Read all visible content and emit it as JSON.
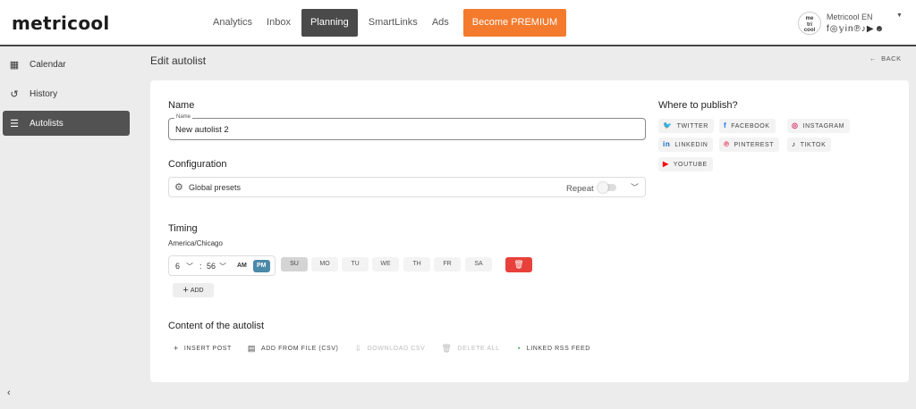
{
  "header": {
    "logo": "metricool",
    "nav": [
      "Analytics",
      "Inbox",
      "Planning",
      "SmartLinks",
      "Ads"
    ],
    "premium": "Become PREMIUM",
    "account": {
      "avatar_text": "me\ntri\ncool",
      "name": "Metricool EN",
      "social_icons": "f◎𝕪in℗♪▶☻"
    }
  },
  "sidebar": {
    "items": [
      {
        "label": "Calendar",
        "icon": "calendar-icon",
        "glyph": "▦"
      },
      {
        "label": "History",
        "icon": "history-icon",
        "glyph": "↺"
      },
      {
        "label": "Autolists",
        "icon": "list-icon",
        "glyph": "☰"
      }
    ],
    "collapse": "‹"
  },
  "page": {
    "title": "Edit autolist",
    "back": "BACK"
  },
  "form": {
    "name_section": "Name",
    "name_field_label": "Name",
    "name_value": "New autolist 2",
    "config_section": "Configuration",
    "config_label": "Global presets",
    "repeat_label": "Repeat",
    "timing_section": "Timing",
    "timezone": "America/Chicago",
    "hour": "6",
    "minute": "56",
    "am": "AM",
    "pm": "PM",
    "days": [
      "SU",
      "MO",
      "TU",
      "WE",
      "TH",
      "FR",
      "SA"
    ],
    "selected_day": "SU",
    "add_label": "ADD",
    "content_section": "Content of the autolist",
    "actions": [
      {
        "label": "INSERT POST",
        "icon": "+",
        "disabled": false
      },
      {
        "label": "ADD FROM FILE (CSV)",
        "icon": "▤",
        "disabled": false
      },
      {
        "label": "DOWNLOAD CSV",
        "icon": "⇩",
        "disabled": true
      },
      {
        "label": "DELETE ALL",
        "icon": "🗑",
        "disabled": true
      },
      {
        "label": "LINKED RSS FEED",
        "icon": "◔",
        "disabled": false
      }
    ]
  },
  "publish": {
    "title": "Where to publish?",
    "networks": [
      {
        "label": "TWITTER",
        "glyph": "🐦",
        "color": "#1d9bf0"
      },
      {
        "label": "FACEBOOK",
        "glyph": "f",
        "color": "#1877f2"
      },
      {
        "label": "INSTAGRAM",
        "glyph": "◎",
        "color": "#d6336c"
      },
      {
        "label": "LINKEDIN",
        "glyph": "in",
        "color": "#0a66c2"
      },
      {
        "label": "PINTEREST",
        "glyph": "℗",
        "color": "#e60023"
      },
      {
        "label": "TIKTOK",
        "glyph": "♪",
        "color": "#111111"
      },
      {
        "label": "YOUTUBE",
        "glyph": "▶",
        "color": "#ff0000"
      }
    ]
  },
  "colors": {
    "premium": "#f47b2d",
    "active_nav": "#4a4a4a",
    "pm_active": "#4b89a8",
    "delete": "#e8413c"
  }
}
